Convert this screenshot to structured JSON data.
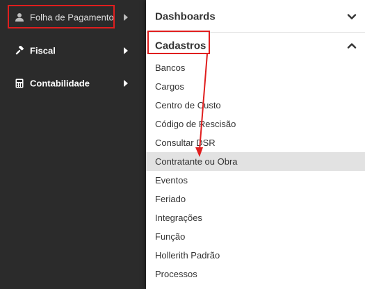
{
  "sidebar": {
    "items": [
      {
        "label": "Folha de Pagamento",
        "icon": "user-icon"
      },
      {
        "label": "Fiscal",
        "icon": "gavel-icon"
      },
      {
        "label": "Contabilidade",
        "icon": "calculator-icon"
      }
    ]
  },
  "panel": {
    "sections": [
      {
        "title": "Dashboards",
        "state": "collapsed",
        "icon": "chevron-down-icon"
      },
      {
        "title": "Cadastros",
        "state": "expanded",
        "icon": "chevron-up-icon"
      }
    ],
    "items": [
      "Bancos",
      "Cargos",
      "Centro de Custo",
      "Código de Rescisão",
      "Consultar DSR",
      "Contratante ou Obra",
      "Eventos",
      "Feriado",
      "Integrações",
      "Função",
      "Hollerith Padrão",
      "Processos"
    ],
    "active_item": "Contratante ou Obra"
  },
  "colors": {
    "sidebar_bg": "#2b2b2b",
    "panel_bg": "#ffffff",
    "active_row": "#e2e2e2",
    "annotation_red": "#e01e1e"
  }
}
